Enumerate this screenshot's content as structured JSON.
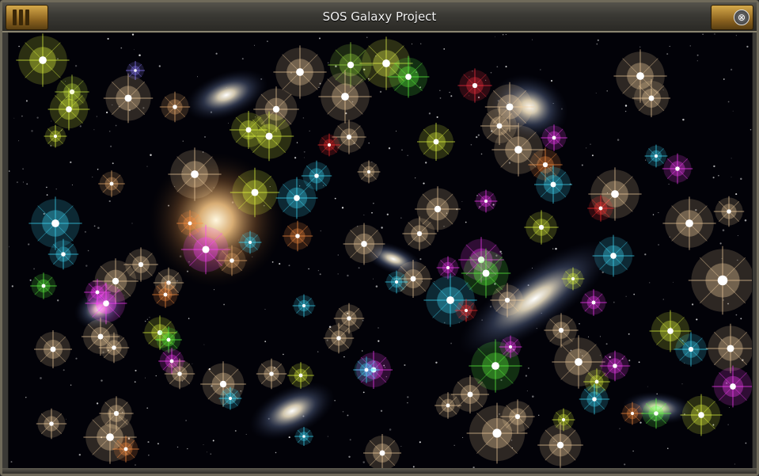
{
  "window": {
    "title": "SOS Galaxy Project",
    "close_glyph": "⊗"
  },
  "colors": {
    "space": "#020208",
    "frame": "#3b3a36",
    "ornament_gold": "#c8973c"
  },
  "icons": {
    "left_ornament": "menu-grip-icon",
    "right_ornament": "close-ornament-icon",
    "close": "close-icon"
  }
}
